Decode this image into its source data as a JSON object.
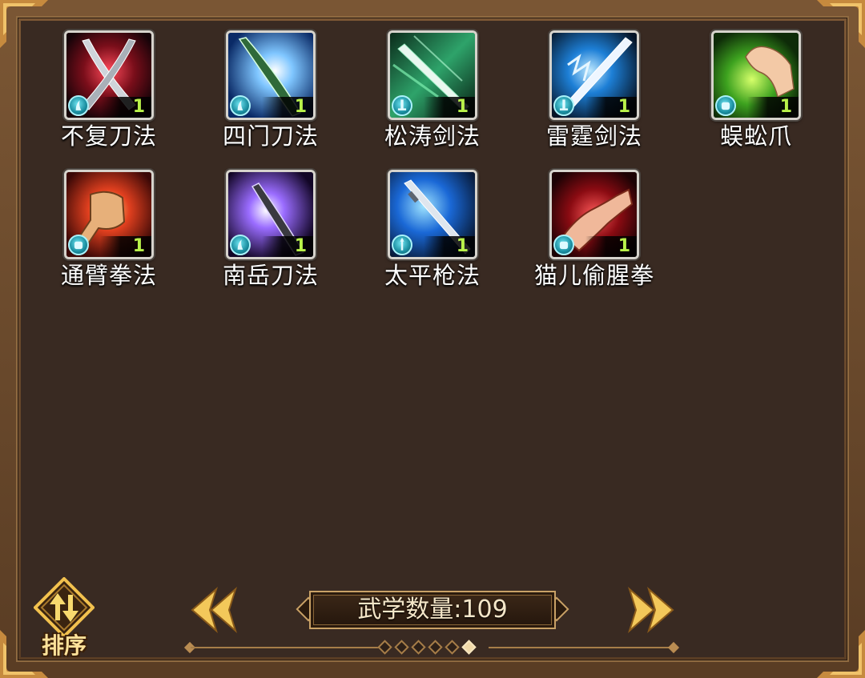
{
  "skills": [
    {
      "name": "不复刀法",
      "level": "1",
      "icon": "crossed-blades-icon",
      "badge": "blade-type-icon"
    },
    {
      "name": "四门刀法",
      "level": "1",
      "icon": "glowing-blade-icon",
      "badge": "blade-type-icon"
    },
    {
      "name": "松涛剑法",
      "level": "1",
      "icon": "green-sword-icon",
      "badge": "sword-type-icon"
    },
    {
      "name": "雷霆剑法",
      "level": "1",
      "icon": "lightning-sword-icon",
      "badge": "sword-type-icon"
    },
    {
      "name": "蜈蚣爪",
      "level": "1",
      "icon": "green-claw-icon",
      "badge": "fist-type-icon"
    },
    {
      "name": "通臂拳法",
      "level": "1",
      "icon": "fist-icon",
      "badge": "fist-type-icon"
    },
    {
      "name": "南岳刀法",
      "level": "1",
      "icon": "purple-blade-icon",
      "badge": "blade-type-icon"
    },
    {
      "name": "太平枪法",
      "level": "1",
      "icon": "spear-icon",
      "badge": "spear-type-icon"
    },
    {
      "name": "猫儿偷腥拳",
      "level": "1",
      "icon": "red-claw-icon",
      "badge": "fist-type-icon"
    }
  ],
  "sort_button": {
    "label": "排序",
    "icon": "sort-arrows-icon"
  },
  "count": {
    "text": "武学数量:109"
  },
  "pagination": {
    "pages": 6,
    "current": 6
  },
  "nav": {
    "prev": "chevron-left-icon",
    "next": "chevron-right-icon"
  },
  "colors": {
    "level": "#b9f24a",
    "accent": "#f2c14e",
    "panel": "#392a22"
  }
}
